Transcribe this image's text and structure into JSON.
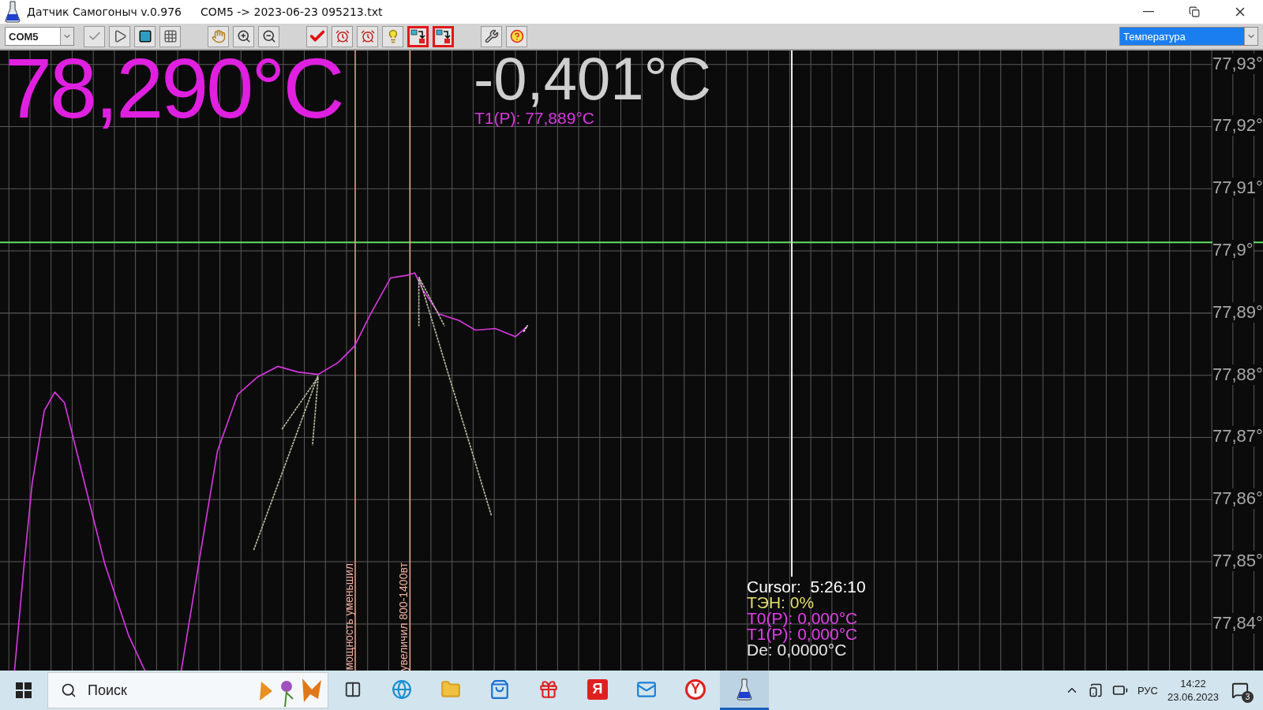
{
  "window": {
    "title": "Датчик Самогоныч v.0.976",
    "file": "COM5 -> 2023-06-23 095213.txt"
  },
  "toolbar": {
    "port": "COM5",
    "groups": [
      [
        {
          "kind": "checkbox",
          "active": false
        },
        {
          "kind": "play",
          "active": false
        },
        {
          "kind": "stop",
          "active": false
        },
        {
          "kind": "grid",
          "active": false
        }
      ],
      [
        {
          "kind": "hand",
          "active": false
        },
        {
          "kind": "zoom-in",
          "active": false
        },
        {
          "kind": "zoom-out",
          "active": false
        }
      ],
      [
        {
          "kind": "check",
          "active": false
        },
        {
          "kind": "alarm",
          "active": false
        },
        {
          "kind": "alarm",
          "active": false
        },
        {
          "kind": "bulb",
          "active": false
        },
        {
          "kind": "export",
          "active": true
        },
        {
          "kind": "export",
          "active": true
        }
      ],
      [
        {
          "kind": "tools",
          "active": false
        },
        {
          "kind": "help",
          "active": false
        }
      ]
    ],
    "channel": "Температура"
  },
  "readout": {
    "temperature": "78,290°C",
    "delta": "-0,401°C",
    "reference": "T1(P): 77,889°C"
  },
  "y_labels": [
    "77,93°",
    "77,92°",
    "77,91°",
    "77,9°",
    "77,89°",
    "77,88°",
    "77,87°",
    "77,86°",
    "77,85°",
    "77,84°"
  ],
  "markers": [
    {
      "label": "мощность уменьшил"
    },
    {
      "label": "увеличил 800-1400вт"
    }
  ],
  "cursor": {
    "time": "Cursor:  5:26:10",
    "lines": [
      {
        "text": "ТЭН: 0%",
        "color": "#e3dc6a"
      },
      {
        "text": "T0(P): 0,000°C",
        "color": "#e040e8"
      },
      {
        "text": "T1(P): 0,000°C",
        "color": "#e040e8"
      },
      {
        "text": "De: 0,0000°C",
        "color": "#e6e6e6"
      }
    ]
  },
  "taskbar": {
    "search_placeholder": "Поиск",
    "apps": [
      {
        "kind": "task-view",
        "selected": false
      },
      {
        "kind": "browser",
        "selected": false
      },
      {
        "kind": "folder",
        "selected": false
      },
      {
        "kind": "store",
        "selected": false
      },
      {
        "kind": "gift",
        "selected": false
      },
      {
        "kind": "letter",
        "glyph": "Я",
        "selected": false
      },
      {
        "kind": "mail",
        "selected": false
      },
      {
        "kind": "letter-round",
        "glyph": "Y",
        "selected": false
      },
      {
        "kind": "flask",
        "selected": true
      }
    ],
    "language": "РУС",
    "time": "14:22",
    "date": "23.06.2023",
    "notifications": "3"
  }
}
